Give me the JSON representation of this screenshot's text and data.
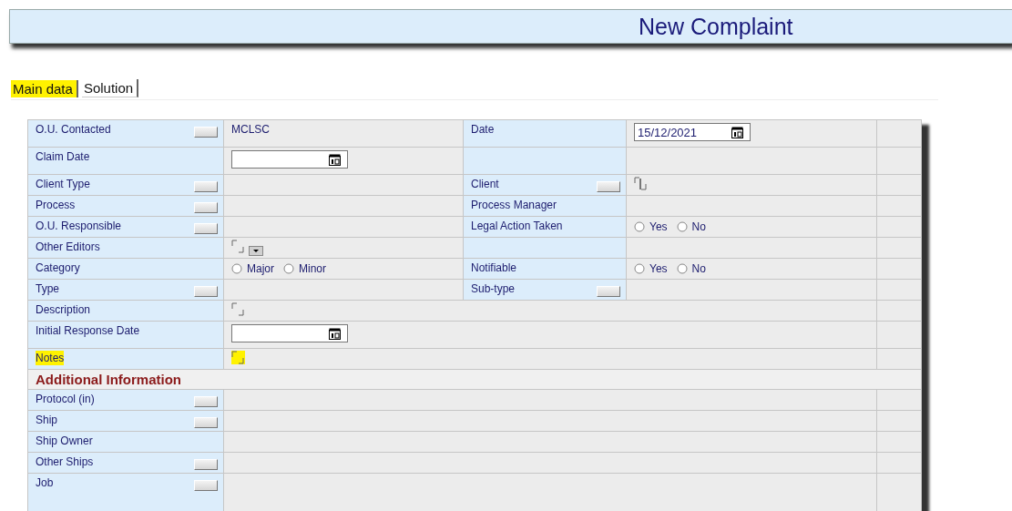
{
  "header": {
    "title": "New Complaint"
  },
  "tabs": [
    {
      "label": "Main data",
      "selected": true,
      "highlighted": true
    },
    {
      "label": "Solution",
      "selected": false,
      "highlighted": false
    }
  ],
  "rows": [
    {
      "kind": "pair",
      "left": {
        "label": "O.U. Contacted",
        "button": true,
        "value": {
          "kind": "text",
          "text": "MCLSC"
        }
      },
      "right": {
        "label": "Date",
        "button": false,
        "value": {
          "kind": "date",
          "text": "15/12/2021"
        }
      }
    },
    {
      "kind": "pair",
      "left": {
        "label": "Claim Date",
        "button": false,
        "value": {
          "kind": "date"
        }
      },
      "right": {
        "button": false,
        "value": {
          "kind": "empty"
        }
      }
    },
    {
      "kind": "pair",
      "left": {
        "label": "Client Type",
        "button": true,
        "value": {
          "kind": "empty"
        }
      },
      "right": {
        "label": "Client",
        "button": true,
        "value": {
          "kind": "memo",
          "focused": true
        }
      }
    },
    {
      "kind": "pair",
      "left": {
        "label": "Process",
        "button": true,
        "value": {
          "kind": "empty"
        }
      },
      "right": {
        "label": "Process Manager",
        "button": false,
        "value": {
          "kind": "empty"
        }
      }
    },
    {
      "kind": "pair",
      "left": {
        "label": "O.U. Responsible",
        "button": true,
        "value": {
          "kind": "empty"
        }
      },
      "right": {
        "label": "Legal Action Taken",
        "button": false,
        "value": {
          "kind": "radios",
          "options": [
            {
              "label": "Yes",
              "selected": false
            },
            {
              "label": "No",
              "selected": false
            }
          ]
        }
      }
    },
    {
      "kind": "pair",
      "left": {
        "label": "Other Editors",
        "button": false,
        "value": {
          "kind": "memo-dropdown"
        }
      },
      "right": {
        "button": false,
        "value": {
          "kind": "empty"
        }
      }
    },
    {
      "kind": "pair",
      "left": {
        "label": "Category",
        "button": false,
        "value": {
          "kind": "radios",
          "options": [
            {
              "label": "Major",
              "selected": false
            },
            {
              "label": "Minor",
              "selected": false
            }
          ]
        }
      },
      "right": {
        "label": "Notifiable",
        "button": false,
        "value": {
          "kind": "radios",
          "options": [
            {
              "label": "Yes",
              "selected": false
            },
            {
              "label": "No",
              "selected": false
            }
          ]
        }
      }
    },
    {
      "kind": "pair",
      "left": {
        "label": "Type",
        "button": true,
        "value": {
          "kind": "empty"
        }
      },
      "right": {
        "label": "Sub-type",
        "button": true,
        "value": {
          "kind": "empty"
        }
      }
    },
    {
      "kind": "wide",
      "left": {
        "label": "Description",
        "button": false,
        "value": {
          "kind": "memo"
        }
      }
    },
    {
      "kind": "wide",
      "left": {
        "label": "Initial Response Date",
        "button": false,
        "value": {
          "kind": "date"
        }
      }
    },
    {
      "kind": "wide",
      "left": {
        "label": "Notes",
        "button": false,
        "highlighted": true,
        "value": {
          "kind": "memo",
          "highlighted": true
        }
      }
    },
    {
      "kind": "section",
      "title": "Additional Information"
    },
    {
      "kind": "wide",
      "left": {
        "label": "Protocol (in)",
        "button": true,
        "value": {
          "kind": "empty"
        }
      }
    },
    {
      "kind": "wide",
      "left": {
        "label": "Ship",
        "button": true,
        "value": {
          "kind": "empty"
        }
      }
    },
    {
      "kind": "wide",
      "left": {
        "label": "Ship Owner",
        "button": false,
        "value": {
          "kind": "empty"
        }
      }
    },
    {
      "kind": "wide",
      "left": {
        "label": "Other Ships",
        "button": true,
        "value": {
          "kind": "empty"
        }
      }
    },
    {
      "kind": "wide",
      "left": {
        "label": "Job",
        "button": true,
        "value": {
          "kind": "empty"
        }
      }
    }
  ]
}
